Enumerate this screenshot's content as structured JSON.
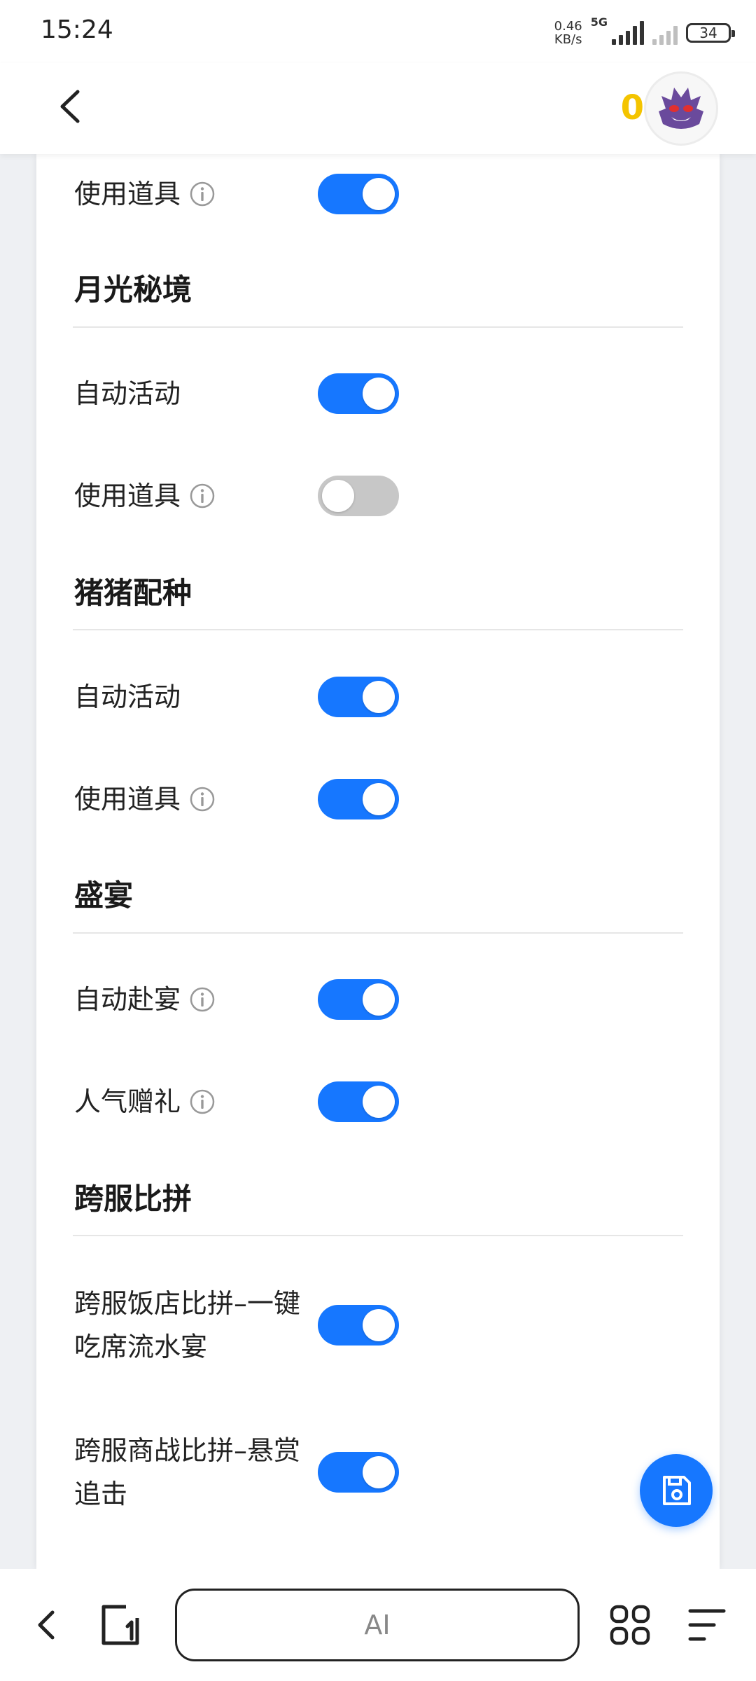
{
  "status_bar": {
    "time": "15:24",
    "net_speed_value": "0.46",
    "net_speed_unit": "KB/s",
    "network": "5G",
    "battery": "34"
  },
  "header": {
    "coin_count": "0",
    "avatar_icon": "purple-ghost-avatar"
  },
  "settings": {
    "top_row": {
      "label": "使用道具",
      "enabled": true
    },
    "sections": [
      {
        "title": "月光秘境",
        "rows": [
          {
            "label": "自动活动",
            "enabled": true
          },
          {
            "label": "使用道具",
            "enabled": false
          }
        ]
      },
      {
        "title": "猪猪配种",
        "rows": [
          {
            "label": "自动活动",
            "enabled": true
          },
          {
            "label": "使用道具",
            "enabled": true
          }
        ]
      },
      {
        "title": "盛宴",
        "rows": [
          {
            "label": "自动赴宴",
            "enabled": true
          },
          {
            "label": "人气赠礼",
            "enabled": true
          }
        ]
      },
      {
        "title": "跨服比拼",
        "rows": [
          {
            "label": "跨服饭店比拼–一键吃席流水宴",
            "enabled": true
          },
          {
            "label": "跨服商战比拼–悬赏追击",
            "enabled": true
          }
        ]
      }
    ]
  },
  "fab": {
    "icon": "save-icon"
  },
  "bottom_bar": {
    "ai_label": "AI",
    "icons": [
      "back-icon",
      "tabs-icon",
      "grid-icon",
      "menu-icon"
    ]
  },
  "colors": {
    "accent": "#1677ff",
    "toggle_off": "#c7c7c7",
    "coin": "#f4c400",
    "background": "#eef0f3"
  }
}
